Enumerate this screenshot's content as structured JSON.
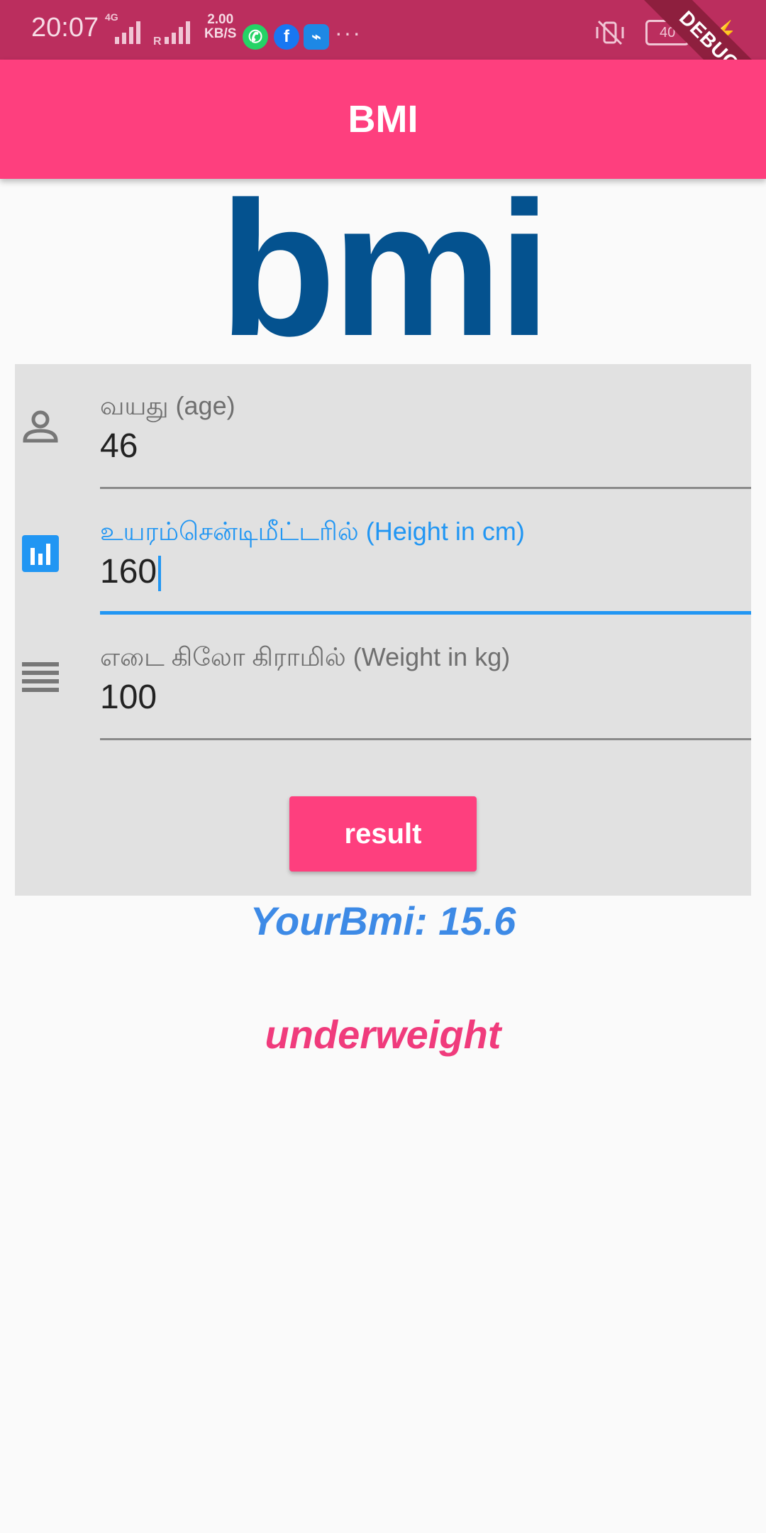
{
  "status_bar": {
    "time": "20:07",
    "network_type": "4G",
    "roaming": "R",
    "speed_value": "2.00",
    "speed_unit": "KB/S",
    "battery": "40",
    "debug_label": "DEBUG",
    "icons": [
      "signal-icon",
      "whatsapp-icon",
      "facebook-icon",
      "usb-icon",
      "more-icon",
      "vibrate-off-icon",
      "battery-icon",
      "charging-icon"
    ]
  },
  "app_bar": {
    "title": "BMI",
    "color": "#fe3f7e"
  },
  "logo": {
    "text": "bmi",
    "color": "#04528f"
  },
  "form": {
    "age": {
      "label": "வயது (age)",
      "value": "46",
      "icon": "person-icon"
    },
    "height": {
      "label": "உயரம்சென்டிமீட்டரில் (Height in cm)",
      "value": "160",
      "icon": "bar-chart-icon",
      "focused": true
    },
    "weight": {
      "label": "எடை கிலோ கிராமில் (Weight in kg)",
      "value": "100",
      "icon": "menu-lines-icon"
    },
    "submit_label": "result"
  },
  "result": {
    "bmi_text": "YourBmi: 15.6",
    "category": "underweight",
    "bmi_color": "#3d8ae6",
    "category_color": "#f03b7c"
  }
}
